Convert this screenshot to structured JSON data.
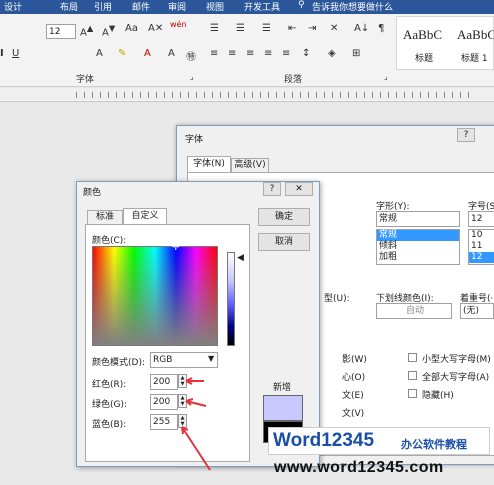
{
  "ribbon": {
    "tabs": [
      "设计",
      "布局",
      "引用",
      "邮件",
      "审阅",
      "视图",
      "开发工具"
    ],
    "search_placeholder": "告诉我你想要做什么",
    "font_size": "12",
    "group_font": "字体",
    "group_paragraph": "段落",
    "styles": [
      {
        "sample": "AaBbC",
        "name": "标题"
      },
      {
        "sample": "AaBbC",
        "name": "标题 1"
      }
    ]
  },
  "font_dialog": {
    "title": "字体",
    "help": "?",
    "tabs": [
      "字体(N)",
      "高级(V)"
    ],
    "style_label": "字形(Y):",
    "style_value": "常规",
    "style_options": [
      "常规",
      "倾斜",
      "加粗"
    ],
    "size_label": "字号(S):",
    "size_value": "12",
    "size_options": [
      "10",
      "11",
      "12"
    ],
    "underline_type_label": "型(U):",
    "underline_color_label": "下划线颜色(I):",
    "underline_color_value": "自动",
    "emphasis_label": "着重号(·)",
    "emphasis_value": "(无)",
    "effects_partial": [
      "影(W)",
      "心(O)",
      "文(E)",
      "文(V)"
    ],
    "checkboxes": [
      "小型大写字母(M)",
      "全部大写字母(A)",
      "隐藏(H)"
    ]
  },
  "color_dialog": {
    "title": "颜色",
    "help": "?",
    "tabs": [
      "标准",
      "自定义"
    ],
    "colors_label": "颜色(C):",
    "ok": "确定",
    "cancel": "取消",
    "model_label": "颜色模式(D):",
    "model_value": "RGB",
    "red_label": "红色(R):",
    "red_value": "200",
    "green_label": "绿色(G):",
    "green_value": "200",
    "blue_label": "蓝色(B):",
    "blue_value": "255",
    "new_label": "新增",
    "new_color": "#c8c8ff"
  },
  "watermark": {
    "brand": "Word12345",
    "slogan": "办公软件教程",
    "url": "www.word12345.com"
  },
  "colors": {
    "accent": "#2b579a",
    "arrow": "#e0343a"
  }
}
